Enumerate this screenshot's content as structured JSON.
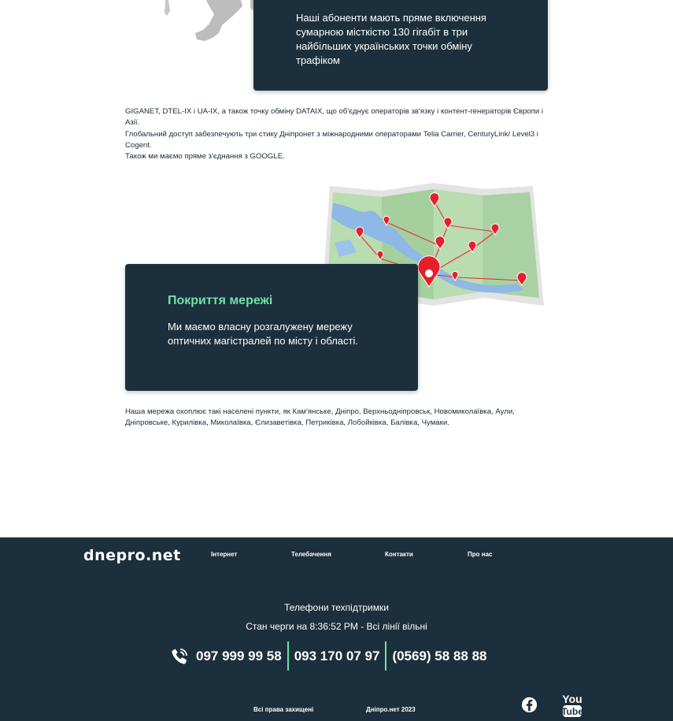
{
  "top_card": {
    "text": "Наші абоненти мають пряме включення сумарною місткістю 130 гігабіт в три найбільших українських точки обміну трафіком"
  },
  "exchange_info": {
    "lines": [
      "GIGANET, DTEL-IX і UA-IX, а також точку обміну DATAIX, що об'єднує операторів зв'язку і контент-генераторів Європи і Азії.",
      "Глобальний доступ забезпечують три стику Дніпронет з міжнародними операторами Telia Carrier, CenturyLink/ Level3 і Cogent.",
      "Також ми маємо пряме з'єднання з GOOGLE."
    ]
  },
  "coverage_card": {
    "title": "Покриття мережі",
    "text": "Ми маємо власну розгалужену мережу оптичних магістралей по місту і області."
  },
  "coverage_info": {
    "text": "Наша мережа охоплює такі населені пункти, як Кам'янське, Дніпро, Верхньодніпровськ, Новомиколаївка, Аули, Дніпровське, Курилівка, Миколаївка, Єлизаветівка, Петриківка, Лобойківка, Балівка, Чумаки."
  },
  "footer": {
    "logo": "dnepro.net",
    "nav": [
      "Інтернет",
      "Телебачення",
      "Контакти",
      "Про нас"
    ],
    "support_title": "Телефони техпідтримки",
    "duty_status": "Стан черги на 8:36:52 PM - Всі лінії вільні",
    "phones": [
      "097 999 99 58",
      "093 170 07 97",
      "(0569) 58 88 88"
    ],
    "rights": "Всі права захищені",
    "brand_year": "Дніпро.нет 2023",
    "youtube_text": [
      "You",
      "Tube"
    ],
    "icons": [
      "phone-icon",
      "facebook-icon",
      "youtube-icon"
    ]
  },
  "colors": {
    "dark": "#1c2f3c",
    "accent": "#6ee3a7",
    "pin": "#e5202b"
  }
}
